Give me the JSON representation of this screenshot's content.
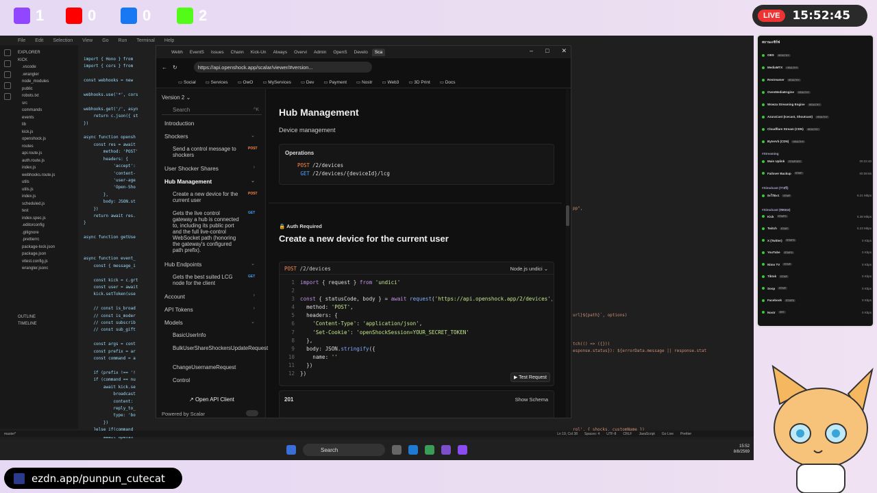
{
  "overlay": {
    "social": [
      {
        "platform": "twitch-icon",
        "count": "1",
        "color": "#9146ff"
      },
      {
        "platform": "youtube-icon",
        "count": "0",
        "color": "#ff0000"
      },
      {
        "platform": "facebook-icon",
        "count": "0",
        "color": "#1877f2"
      },
      {
        "platform": "kick-icon",
        "count": "2",
        "color": "#53fc18"
      }
    ],
    "live_label": "LIVE",
    "clock": "15:52:45",
    "handle": "ezdn.app/punpun_cutecat"
  },
  "vscode": {
    "menu": [
      "File",
      "Edit",
      "Selection",
      "View",
      "Go",
      "Run",
      "Terminal",
      "Help"
    ],
    "explorer_title": "EXPLORER",
    "explorer_items": [
      "KICK",
      ".vscode",
      ".wrangler",
      "node_modules",
      "public",
      "robots.txt",
      "src",
      "commands",
      "events",
      "lib",
      "kick.js",
      "openshock.js",
      "routes",
      "api.route.js",
      "auth.route.js",
      "index.js",
      "webhooks.route.js",
      "utils",
      "utils.js",
      "index.js",
      "scheduled.js",
      "test",
      "index.spec.js",
      ".editorconfig",
      ".gitignore",
      ".prettierrc",
      "package-lock.json",
      "package.json",
      "vitest.config.js",
      "wrangler.jsonc"
    ],
    "outline": "OUTLINE",
    "timeline": "TIMELINE",
    "statusbar": [
      "master*",
      "Ln 19, Col 38",
      "Spaces: 4",
      "UTF-8",
      "CRLF",
      "JavaScript",
      "Go Live",
      "Prettier"
    ],
    "code_left": "import { Hono } from\nimport { cors } from\n\nconst webhooks = new\n\nwebhooks.use('*', cors\n\nwebhooks.get('/', asyn\n    return c.json({ st\n})\n\nasync function opensh\n    const res = await\n        method: 'POST'\n        headers: {\n            'accept':\n            'content-\n            'user-age\n            'Open-Sho\n        },\n        body: JSON.st\n    })\n    return await res.\n}\n\nasync function getUse\n\n\nasync function event_\n    const { message_i\n\n    const kick = c.grt\n    const user = await\n    kick.setToken(use\n\n    // const is_broad\n    // const is_moder\n    // const subscrib\n    // const sub_gift\n\n    const args = cont\n    const prefix = ar\n    const command = a\n\n    if (prefix !== '!\n    if (command == nu\n        await kick.se\n            broadcast\n            content:\n            reply_to_\n            type: 'bo\n        })\n    }else if(command\n        await opensh",
    "code_right": "pp\",\n\n\n\n\n\n\n\n\n\n\n\n\n\n\nurl}${path}`, options)\n\n\n\ntch(() => ({}))\nesponse.status}): ${errorData.message || response.stat\n\n\n\n\n\n\n\n\n\n\nrol', { shocks, customName })"
  },
  "taskbar": {
    "search": "Search",
    "time": "15:52",
    "date": "8/8/2569"
  },
  "browser": {
    "tabs": [
      "Webh",
      "EventS",
      "Issues",
      "Chann",
      "Kick-Un",
      "Always",
      "Overvi",
      "Admin",
      "OpenS",
      "Develo",
      "Sca"
    ],
    "url": "https://api.openshock.app/scalar/viewer/#version...",
    "bookmarks": [
      "Social",
      "Services",
      "OwO",
      "MyServices",
      "Dev",
      "Payment",
      "Nostr",
      "Web3",
      "3D Print",
      "Docs"
    ],
    "sidebar": {
      "version": "Version 2",
      "search_placeholder": "Search",
      "search_shortcut": "^K",
      "nav": [
        {
          "label": "Introduction",
          "kind": "top"
        },
        {
          "label": "Shockers",
          "kind": "group",
          "chev": "⌄"
        },
        {
          "label": "Send a control message to shockers",
          "kind": "sub",
          "method": "POST"
        },
        {
          "label": "User Shocker Shares",
          "kind": "group",
          "chev": "›"
        },
        {
          "label": "Hub Management",
          "kind": "group-active",
          "chev": "⌄"
        },
        {
          "label": "Create a new device for the current user",
          "kind": "sub",
          "method": "POST"
        },
        {
          "label": "Gets the live control gateway a hub is connected to, including its public port and the full live-control WebSocket path (honoring the gateway's configured path prefix).",
          "kind": "sub",
          "method": "GET"
        },
        {
          "label": "Hub Endpoints",
          "kind": "group",
          "chev": "⌄"
        },
        {
          "label": "Gets the best suited LCG node for the client",
          "kind": "sub",
          "method": "GET"
        },
        {
          "label": "Account",
          "kind": "group",
          "chev": "›"
        },
        {
          "label": "API Tokens",
          "kind": "group",
          "chev": "›"
        },
        {
          "label": "Models",
          "kind": "group",
          "chev": "⌄"
        },
        {
          "label": "BasicUserInfo",
          "kind": "sub"
        },
        {
          "label": "BulkUserShareShockersUpdateRequest",
          "kind": "sub"
        },
        {
          "label": "ChangeUsernameRequest",
          "kind": "sub"
        },
        {
          "label": "Control",
          "kind": "sub"
        }
      ],
      "open_api": "Open API Client",
      "powered_by": "Powered by Scalar"
    },
    "main": {
      "title": "Hub Management",
      "description": "Device management",
      "operations_label": "Operations",
      "operations": [
        {
          "method": "POST",
          "path": "/2/devices",
          "color": "#ff8a4c"
        },
        {
          "method": "GET",
          "path": "/2/devices/{deviceId}/lcg",
          "color": "#4ea1ff"
        }
      ],
      "auth_required": "Auth Required",
      "endpoint_title": "Create a new device for the current user",
      "code_method": "POST",
      "code_path": "/2/devices",
      "code_lang": "Node.js undici",
      "test_request": "Test Request",
      "response_code": "201",
      "show_schema": "Show Schema"
    }
  },
  "status_panel": {
    "title": "สถานะเซิร์ฟ",
    "services": [
      {
        "name": "OBS",
        "tag": "HEALTHY"
      },
      {
        "name": "MediaMTX",
        "tag": "HEALTHY"
      },
      {
        "name": "Restreamer",
        "tag": "HEALTHY"
      },
      {
        "name": "OvenMediaEngine",
        "tag": "HEALTHY"
      },
      {
        "name": "Wowza Streaming Engine",
        "tag": "HEALTHY"
      },
      {
        "name": "AzuraCast (Icecast, Shoutcast)",
        "tag": "HEALTHY"
      },
      {
        "name": "Cloudflare Stream (CDN)",
        "tag": "HEALTHY"
      },
      {
        "name": "ByteArk (CDN)",
        "tag": "HEALTHY"
      }
    ],
    "streaming_label": "#Streaming",
    "streaming": [
      {
        "name": "Main Uplink",
        "tag": "RTMP/SRT",
        "right": "00:22:40"
      },
      {
        "name": "Failover Backup",
        "tag": "RTMP",
        "right": "00:39:56"
      }
    ],
    "simulcast_a_label": "#Simulcast (รายปี)",
    "simulcast_a": [
      {
        "name": "อะไรอะ1",
        "tag": "RTMP",
        "right": "6.21 Mbps"
      }
    ],
    "simulcast_b_label": "#Simulcast (ทดลอง)",
    "simulcast_b": [
      {
        "name": "Kick",
        "tag": "RTMPS",
        "right": "5.38 Mbps"
      },
      {
        "name": "Twitch",
        "tag": "RTMP",
        "right": "5.23 Mbps"
      },
      {
        "name": "X (Twitter)",
        "tag": "RTMPS",
        "right": "0 Kbps"
      },
      {
        "name": "YouTube",
        "tag": "RTMPS",
        "right": "0 Kbps"
      },
      {
        "name": "Nimo TV",
        "tag": "RTMP",
        "right": "0 Kbps"
      },
      {
        "name": "Tiktok",
        "tag": "RTMP",
        "right": "0 Kbps"
      },
      {
        "name": "Soop",
        "tag": "RTMP",
        "right": "0 Kbps"
      },
      {
        "name": "Facebook",
        "tag": "RTMPS",
        "right": "0 Kbps"
      },
      {
        "name": "Nostr",
        "tag": "SRT",
        "right": "0 Kbps"
      }
    ]
  }
}
